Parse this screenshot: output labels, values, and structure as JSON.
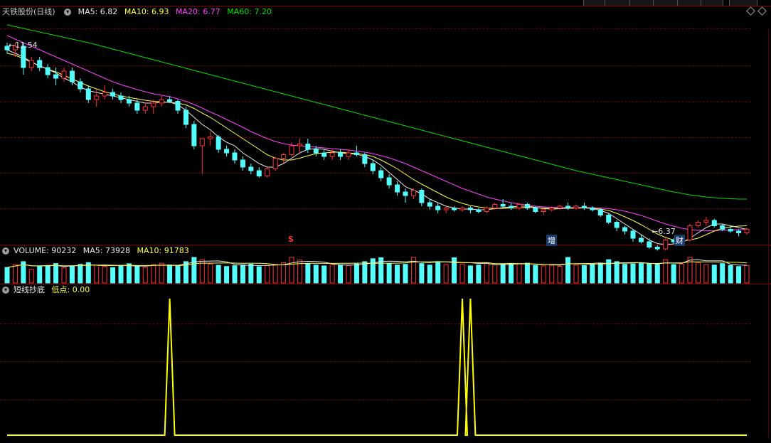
{
  "price": {
    "stock_name": "天铁股份",
    "period": "(日线)",
    "ma5_label": "MA5: 6.82",
    "ma10_label": "MA10: 6.93",
    "ma20_label": "MA20: 6.77",
    "ma60_label": "MA60: 7.20",
    "high_label": "11.54",
    "low_label": "6.37",
    "markers": [
      "S",
      "增",
      "财"
    ]
  },
  "volume": {
    "label": "VOLUME: 90232",
    "ma5_label": "MA5: 73928",
    "ma10_label": "MA10: 91783"
  },
  "indicator": {
    "name": "短线抄底",
    "value_label": "低点: 0.00"
  },
  "colors": {
    "up": "#ff3232",
    "down": "#54ffff",
    "ma5": "#e8e8e8",
    "ma10": "#ffff40",
    "ma20": "#ff40ff",
    "ma60": "#00e000",
    "signal": "#ffff00"
  },
  "chart_data": [
    {
      "type": "candlestick",
      "ylim": [
        6.2,
        12.2
      ],
      "bars": [
        [
          11.5,
          11.6,
          11.3,
          11.4
        ],
        [
          11.4,
          11.6,
          11.2,
          11.5
        ],
        [
          11.5,
          11.6,
          10.7,
          10.9
        ],
        [
          10.9,
          11.2,
          10.8,
          11.1
        ],
        [
          11.1,
          11.2,
          10.8,
          10.9
        ],
        [
          10.9,
          11.0,
          10.6,
          10.7
        ],
        [
          10.7,
          10.9,
          10.4,
          10.6
        ],
        [
          10.6,
          10.9,
          10.5,
          10.8
        ],
        [
          10.8,
          10.9,
          10.4,
          10.5
        ],
        [
          10.5,
          10.6,
          10.2,
          10.3
        ],
        [
          10.3,
          10.4,
          9.9,
          10.0
        ],
        [
          10.0,
          10.3,
          9.8,
          10.1
        ],
        [
          10.1,
          10.4,
          10.0,
          10.2
        ],
        [
          10.2,
          10.3,
          10.0,
          10.1
        ],
        [
          10.1,
          10.2,
          9.9,
          10.0
        ],
        [
          10.0,
          10.1,
          9.8,
          9.9
        ],
        [
          9.9,
          10.0,
          9.6,
          9.7
        ],
        [
          9.7,
          9.9,
          9.6,
          9.8
        ],
        [
          9.8,
          10.0,
          9.6,
          9.9
        ],
        [
          9.9,
          10.1,
          9.8,
          10.0
        ],
        [
          10.0,
          10.1,
          9.9,
          9.95
        ],
        [
          9.95,
          10.0,
          9.6,
          9.7
        ],
        [
          9.7,
          9.8,
          9.2,
          9.3
        ],
        [
          9.3,
          9.4,
          8.6,
          8.7
        ],
        [
          8.7,
          8.9,
          7.9,
          8.9
        ],
        [
          8.9,
          9.1,
          8.7,
          8.95
        ],
        [
          8.95,
          9.0,
          8.5,
          8.6
        ],
        [
          8.6,
          8.7,
          8.4,
          8.5
        ],
        [
          8.5,
          8.6,
          8.2,
          8.3
        ],
        [
          8.3,
          8.4,
          8.0,
          8.1
        ],
        [
          8.1,
          8.2,
          7.9,
          8.0
        ],
        [
          8.0,
          8.1,
          7.8,
          7.85
        ],
        [
          7.85,
          8.1,
          7.8,
          8.05
        ],
        [
          8.05,
          8.4,
          8.0,
          8.35
        ],
        [
          8.35,
          8.5,
          8.2,
          8.45
        ],
        [
          8.45,
          8.8,
          8.4,
          8.7
        ],
        [
          8.7,
          8.9,
          8.5,
          8.75
        ],
        [
          8.75,
          8.9,
          8.5,
          8.6
        ],
        [
          8.6,
          8.7,
          8.4,
          8.5
        ],
        [
          8.5,
          8.6,
          8.3,
          8.4
        ],
        [
          8.4,
          8.6,
          8.3,
          8.5
        ],
        [
          8.5,
          8.6,
          8.3,
          8.4
        ],
        [
          8.4,
          8.6,
          8.3,
          8.5
        ],
        [
          8.5,
          8.7,
          8.4,
          8.45
        ],
        [
          8.45,
          8.5,
          8.1,
          8.2
        ],
        [
          8.2,
          8.3,
          7.9,
          8.0
        ],
        [
          8.0,
          8.1,
          7.7,
          7.8
        ],
        [
          7.8,
          7.9,
          7.5,
          7.6
        ],
        [
          7.6,
          7.7,
          7.3,
          7.4
        ],
        [
          7.4,
          7.5,
          7.1,
          7.3
        ],
        [
          7.3,
          7.5,
          7.2,
          7.45
        ],
        [
          7.45,
          7.5,
          7.0,
          7.1
        ],
        [
          7.1,
          7.2,
          6.9,
          7.0
        ],
        [
          7.0,
          7.1,
          6.8,
          6.9
        ],
        [
          6.9,
          7.0,
          6.8,
          6.95
        ],
        [
          6.95,
          7.0,
          6.85,
          6.9
        ],
        [
          6.9,
          7.0,
          6.85,
          6.95
        ],
        [
          6.95,
          7.0,
          6.8,
          6.9
        ],
        [
          6.9,
          6.95,
          6.8,
          6.85
        ],
        [
          6.85,
          7.0,
          6.8,
          6.95
        ],
        [
          6.95,
          7.1,
          6.9,
          7.05
        ],
        [
          7.05,
          7.2,
          6.95,
          7.0
        ],
        [
          7.0,
          7.1,
          6.9,
          6.95
        ],
        [
          6.95,
          7.1,
          6.9,
          7.05
        ],
        [
          7.05,
          7.1,
          6.9,
          6.95
        ],
        [
          6.95,
          7.0,
          6.8,
          6.85
        ],
        [
          6.85,
          6.95,
          6.75,
          6.9
        ],
        [
          6.9,
          7.0,
          6.85,
          6.95
        ],
        [
          6.95,
          7.05,
          6.9,
          7.0
        ],
        [
          7.0,
          7.1,
          6.9,
          6.95
        ],
        [
          6.95,
          7.05,
          6.9,
          7.0
        ],
        [
          7.0,
          7.1,
          6.9,
          6.95
        ],
        [
          6.95,
          7.0,
          6.85,
          6.9
        ],
        [
          6.9,
          6.95,
          6.7,
          6.75
        ],
        [
          6.75,
          6.8,
          6.5,
          6.55
        ],
        [
          6.55,
          6.6,
          6.3,
          6.4
        ],
        [
          6.4,
          6.45,
          6.2,
          6.3
        ],
        [
          6.3,
          6.35,
          6.0,
          6.1
        ],
        [
          6.1,
          6.2,
          5.95,
          6.0
        ],
        [
          6.0,
          6.1,
          5.8,
          5.85
        ],
        [
          5.85,
          5.9,
          5.75,
          5.8
        ],
        [
          5.8,
          6.1,
          5.75,
          6.05
        ],
        [
          6.05,
          6.1,
          5.95,
          6.0
        ],
        [
          6.0,
          6.1,
          5.9,
          6.05
        ],
        [
          6.05,
          6.5,
          6.0,
          6.45
        ],
        [
          6.45,
          6.6,
          6.4,
          6.55
        ],
        [
          6.55,
          6.7,
          6.45,
          6.6
        ],
        [
          6.6,
          6.65,
          6.4,
          6.45
        ],
        [
          6.45,
          6.5,
          6.3,
          6.35
        ],
        [
          6.35,
          6.45,
          6.25,
          6.3
        ],
        [
          6.3,
          6.35,
          6.15,
          6.25
        ],
        [
          6.25,
          6.4,
          6.2,
          6.35
        ]
      ],
      "ma5": [
        11.4,
        11.3,
        11.2,
        11.05,
        10.95,
        10.85,
        10.75,
        10.6,
        10.5,
        10.35,
        10.25,
        10.2,
        10.15,
        10.1,
        10.05,
        10.0,
        9.95,
        9.9,
        9.9,
        9.92,
        9.93,
        9.85,
        9.7,
        9.5,
        9.3,
        9.15,
        8.95,
        8.8,
        8.7,
        8.5,
        8.35,
        8.2,
        8.1,
        8.1,
        8.2,
        8.35,
        8.5,
        8.6,
        8.62,
        8.6,
        8.55,
        8.5,
        8.48,
        8.46,
        8.4,
        8.3,
        8.15,
        7.95,
        7.75,
        7.55,
        7.45,
        7.35,
        7.2,
        7.1,
        7.0,
        6.95,
        6.92,
        6.92,
        6.9,
        6.9,
        6.93,
        6.96,
        6.98,
        7.0,
        7.0,
        6.97,
        6.93,
        6.92,
        6.93,
        6.95,
        6.96,
        6.96,
        6.94,
        6.88,
        6.8,
        6.65,
        6.5,
        6.35,
        6.2,
        6.05,
        5.95,
        5.92,
        5.94,
        5.97,
        6.1,
        6.25,
        6.4,
        6.5,
        6.5,
        6.45,
        6.4,
        6.35
      ],
      "ma10": [
        11.3,
        11.25,
        11.15,
        11.05,
        10.95,
        10.85,
        10.78,
        10.68,
        10.58,
        10.48,
        10.38,
        10.3,
        10.22,
        10.16,
        10.1,
        10.06,
        10.02,
        9.98,
        9.95,
        9.94,
        9.92,
        9.9,
        9.85,
        9.75,
        9.62,
        9.5,
        9.35,
        9.2,
        9.05,
        8.9,
        8.75,
        8.6,
        8.45,
        8.35,
        8.3,
        8.3,
        8.35,
        8.42,
        8.48,
        8.5,
        8.52,
        8.52,
        8.5,
        8.48,
        8.45,
        8.4,
        8.3,
        8.18,
        8.05,
        7.9,
        7.75,
        7.62,
        7.5,
        7.38,
        7.26,
        7.16,
        7.08,
        7.02,
        6.98,
        6.95,
        6.94,
        6.94,
        6.95,
        6.96,
        6.97,
        6.96,
        6.95,
        6.94,
        6.94,
        6.94,
        6.95,
        6.95,
        6.94,
        6.92,
        6.88,
        6.8,
        6.7,
        6.6,
        6.48,
        6.35,
        6.22,
        6.12,
        6.05,
        6.02,
        6.05,
        6.1,
        6.2,
        6.3,
        6.38,
        6.42,
        6.44,
        6.45
      ],
      "ma20": [
        11.8,
        11.7,
        11.6,
        11.5,
        11.4,
        11.3,
        11.2,
        11.1,
        11.0,
        10.9,
        10.8,
        10.7,
        10.6,
        10.5,
        10.42,
        10.35,
        10.28,
        10.22,
        10.16,
        10.12,
        10.08,
        10.02,
        9.95,
        9.86,
        9.76,
        9.65,
        9.55,
        9.44,
        9.33,
        9.22,
        9.1,
        9.0,
        8.9,
        8.82,
        8.76,
        8.72,
        8.7,
        8.68,
        8.66,
        8.64,
        8.62,
        8.6,
        8.58,
        8.55,
        8.52,
        8.48,
        8.42,
        8.36,
        8.28,
        8.2,
        8.1,
        8.0,
        7.9,
        7.8,
        7.7,
        7.6,
        7.5,
        7.42,
        7.34,
        7.26,
        7.2,
        7.15,
        7.1,
        7.06,
        7.03,
        7.0,
        6.98,
        6.97,
        6.96,
        6.96,
        6.96,
        6.96,
        6.96,
        6.95,
        6.93,
        6.9,
        6.86,
        6.8,
        6.74,
        6.66,
        6.58,
        6.5,
        6.44,
        6.38,
        6.34,
        6.32,
        6.31,
        6.31,
        6.32,
        6.33,
        6.34,
        6.35
      ],
      "ma60": [
        12.1,
        12.05,
        12.0,
        11.95,
        11.9,
        11.85,
        11.8,
        11.75,
        11.7,
        11.65,
        11.6,
        11.54,
        11.48,
        11.42,
        11.36,
        11.3,
        11.24,
        11.18,
        11.12,
        11.06,
        11.0,
        10.94,
        10.88,
        10.82,
        10.76,
        10.7,
        10.64,
        10.58,
        10.52,
        10.46,
        10.4,
        10.34,
        10.28,
        10.22,
        10.16,
        10.1,
        10.04,
        9.98,
        9.92,
        9.86,
        9.8,
        9.74,
        9.68,
        9.62,
        9.56,
        9.5,
        9.44,
        9.38,
        9.32,
        9.26,
        9.2,
        9.14,
        9.08,
        9.02,
        8.96,
        8.9,
        8.84,
        8.78,
        8.72,
        8.66,
        8.6,
        8.54,
        8.48,
        8.42,
        8.36,
        8.3,
        8.24,
        8.18,
        8.12,
        8.06,
        8.0,
        7.95,
        7.9,
        7.85,
        7.8,
        7.75,
        7.7,
        7.65,
        7.6,
        7.55,
        7.5,
        7.45,
        7.4,
        7.36,
        7.32,
        7.29,
        7.26,
        7.24,
        7.22,
        7.21,
        7.2,
        7.2
      ]
    },
    {
      "type": "bar",
      "ylim": [
        0,
        250000
      ],
      "values": [
        80000,
        95000,
        110000,
        70000,
        85000,
        90000,
        100000,
        78000,
        88000,
        96000,
        105000,
        92000,
        84000,
        79000,
        91000,
        99000,
        86000,
        80000,
        95000,
        102000,
        93000,
        87000,
        110000,
        150000,
        120000,
        98000,
        91000,
        85000,
        89000,
        93000,
        97000,
        84000,
        90000,
        96000,
        104000,
        140000,
        118000,
        100000,
        92000,
        88000,
        95000,
        93000,
        90000,
        98000,
        110000,
        125000,
        130000,
        100000,
        92000,
        96000,
        145000,
        100000,
        92000,
        110000,
        95000,
        130000,
        98000,
        88000,
        92000,
        100000,
        94000,
        97000,
        101000,
        99000,
        102000,
        90000,
        88000,
        91000,
        86000,
        140000,
        93000,
        90000,
        95000,
        100000,
        120000,
        110000,
        96000,
        98000,
        102000,
        100000,
        95000,
        120000,
        95000,
        98000,
        180000,
        105000,
        95000,
        92000,
        100000,
        90000,
        85000,
        90232
      ]
    },
    {
      "type": "line",
      "ylim": [
        0,
        1
      ],
      "spikes": [
        20,
        56,
        57
      ]
    }
  ]
}
